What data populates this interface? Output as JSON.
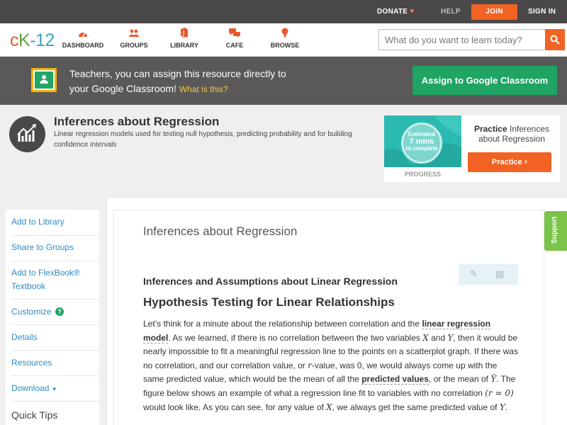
{
  "topbar": {
    "donate": "DONATE",
    "help": "HELP",
    "join": "JOIN",
    "sign_in": "SIGN IN"
  },
  "nav": {
    "logo_c": "c",
    "logo_k": "K",
    "logo_num": "-12",
    "items": [
      {
        "label": "DASHBOARD",
        "icon": "dashboard-icon"
      },
      {
        "label": "GROUPS",
        "icon": "groups-icon"
      },
      {
        "label": "LIBRARY",
        "icon": "library-icon"
      },
      {
        "label": "CAFE",
        "icon": "cafe-icon"
      },
      {
        "label": "BROWSE",
        "icon": "browse-icon"
      }
    ],
    "search_placeholder": "What do you want to learn today?"
  },
  "classroom_banner": {
    "line1": "Teachers, you can assign this resource directly to",
    "line2": "your Google Classroom!",
    "what_link": "What is this?",
    "button": "Assign to Google Classroom"
  },
  "lesson": {
    "title": "Inferences about Regression",
    "description": "Linear regression models used for testing null hypothesis, predicting probability and for building confidence intervals"
  },
  "practice_card": {
    "estimated_line1": "Estimated",
    "estimated_line2": "7 mins",
    "estimated_line3": "to complete",
    "progress_label": "PROGRESS",
    "title_bold": "Practice",
    "title_rest": "Inferences about Regression",
    "button": "Practice"
  },
  "sidebar": {
    "items": [
      "Add to Library",
      "Share to Groups",
      "Add to FlexBook® Textbook",
      "Customize",
      "Details",
      "Resources",
      "Download"
    ],
    "quick_tips": "Quick Tips"
  },
  "content": {
    "title": "Inferences about Regression",
    "section_heading": "Inferences and Assumptions about Linear Regression",
    "subheading": "Hypothesis Testing for Linear Relationships",
    "p_part1": "Let’s think for a minute about the relationship between correlation and the ",
    "term1": "linear regression model",
    "p_part2": ". As we learned, if there is no correlation between the two variables ",
    "var_x": "X",
    "p_part3": " and ",
    "var_y": "Y",
    "p_part4": ", then it would be nearly impossible to fit a meaningful regression line to the points on a scatterplot graph. If there was no correlation, and our correlation value, or ",
    "var_r": "r",
    "p_part5": "-value, was 0, we would always come up with the same predicted value, which would be the mean of all the ",
    "term2": "predicted values",
    "p_part6": ", or the mean of ",
    "var_yhat": "Ŷ",
    "p_part7": ". The figure below shows an example of what a regression line fit to variables with no correlation ",
    "math_r0": "(r = 0)",
    "p_part8": " would look like. As you can see, for any value of ",
    "var_x2": "X",
    "p_part9": ", we always get the same predicted value of ",
    "var_y2": "Y",
    "p_part10": "."
  },
  "support_tab": "Support",
  "colors": {
    "accent_orange": "#f26222",
    "classroom_green": "#1fa463",
    "link_blue": "#318ac2"
  }
}
